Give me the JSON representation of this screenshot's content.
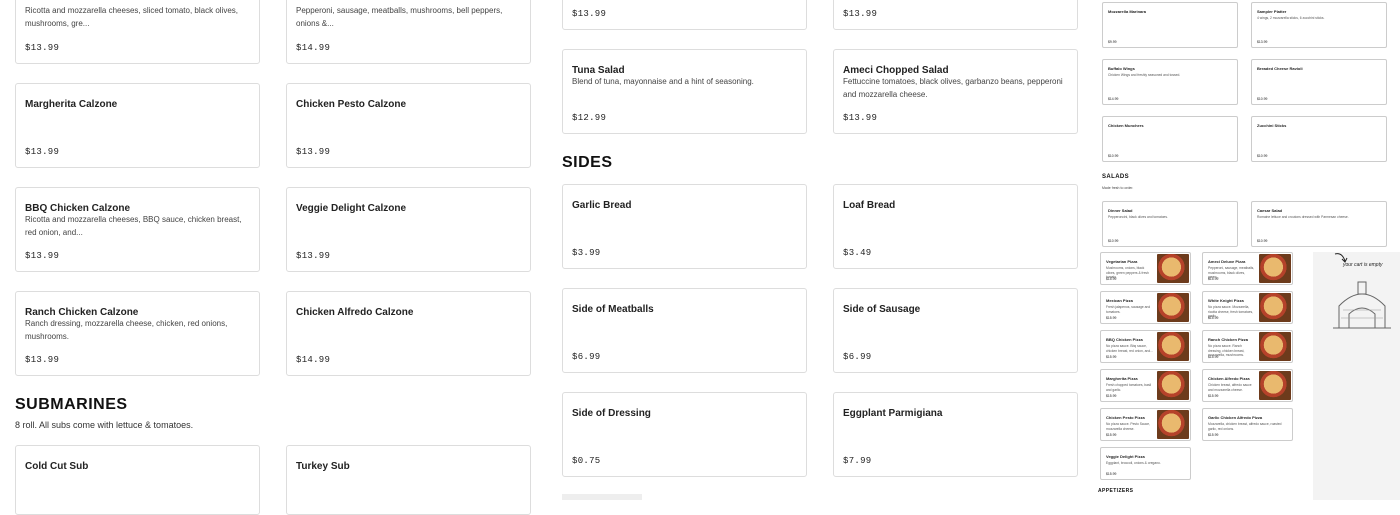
{
  "col1": [
    {
      "name": "",
      "desc": "Ricotta and mozzarella cheeses, sliced tomato, black olives, mushrooms, gre...",
      "price": "$13.99"
    },
    {
      "name": "Margherita Calzone",
      "desc": "",
      "price": "$13.99"
    },
    {
      "name": "BBQ Chicken Calzone",
      "desc": "Ricotta and mozzarella cheeses, BBQ sauce, chicken breast, red onion, and...",
      "price": "$13.99"
    },
    {
      "name": "Ranch Chicken Calzone",
      "desc": "Ranch dressing, mozzarella cheese, chicken, red onions, mushrooms.",
      "price": "$13.99"
    }
  ],
  "col2": [
    {
      "name": "",
      "desc": "Pepperoni, sausage, meatballs, mushrooms, bell peppers, onions &...",
      "price": "$14.99"
    },
    {
      "name": "Chicken Pesto Calzone",
      "desc": "",
      "price": "$13.99"
    },
    {
      "name": "Veggie Delight Calzone",
      "desc": "",
      "price": "$13.99"
    },
    {
      "name": "Chicken Alfredo Calzone",
      "desc": "",
      "price": "$14.99"
    }
  ],
  "submarines": {
    "title": "SUBMARINES",
    "subtitle": "8 roll. All subs come with lettuce & tomatoes.",
    "items": [
      {
        "name": "Cold Cut Sub"
      },
      {
        "name": "Turkey Sub"
      }
    ]
  },
  "col3": [
    {
      "name": "",
      "desc": "",
      "price": "$13.99"
    },
    {
      "name": "Tuna Salad",
      "desc": "Blend of tuna, mayonnaise and a hint of seasoning.",
      "price": "$12.99"
    }
  ],
  "col4": [
    {
      "name": "",
      "desc": "",
      "price": "$13.99"
    },
    {
      "name": "Ameci Chopped Salad",
      "desc": "Fettuccine tomatoes, black olives, garbanzo beans, pepperoni and mozzarella cheese.",
      "price": "$13.99"
    }
  ],
  "sides": {
    "title": "SIDES",
    "items": [
      {
        "name": "Garlic Bread",
        "price": "$3.99"
      },
      {
        "name": "Loaf Bread",
        "price": "$3.49"
      },
      {
        "name": "Side of Meatballs",
        "price": "$6.99"
      },
      {
        "name": "Side of Sausage",
        "price": "$6.99"
      },
      {
        "name": "Side of Dressing",
        "price": "$0.75"
      },
      {
        "name": "Eggplant Parmigiana",
        "price": "$7.99"
      }
    ]
  },
  "preview": {
    "top": [
      {
        "name": "Mozzarella Marinara",
        "desc": "",
        "price": "$9.99"
      },
      {
        "name": "Sampler Platter",
        "desc": "4 wings, 2 mozzarella sticks, 6 zucchini sticks.",
        "price": "$13.99"
      },
      {
        "name": "Buffalo Wings",
        "desc": "Chicken Wings and freshly seasoned and tossed.",
        "price": "$14.99"
      },
      {
        "name": "Breaded Cheese Ravioli",
        "desc": "",
        "price": "$10.99"
      },
      {
        "name": "Chicken Munchers",
        "desc": "",
        "price": "$10.99"
      },
      {
        "name": "Zucchini Sticks",
        "desc": "",
        "price": "$10.99"
      }
    ],
    "salads_title": "SALADS",
    "salads_sub": "Made fresh to order.",
    "salads": [
      {
        "name": "Dinner Salad",
        "desc": "Pepperoncini, black olives and tomatoes.",
        "price": "$10.99"
      },
      {
        "name": "Caesar Salad",
        "desc": "Romaine lettuce and croutons dressed with Parmesan cheese.",
        "price": "$10.99"
      }
    ],
    "pizzas": [
      {
        "name": "Vegetarian Pizza",
        "desc": "Mushrooms, onions, black olives, green peppers & fresh tomato.",
        "price": "$15.99"
      },
      {
        "name": "Ameci Deluxe Pizza",
        "desc": "Pepperoni, sausage, meatballs, mushrooms, black olives, green...",
        "price": "$15.99"
      },
      {
        "name": "Mexican Pizza",
        "desc": "Fresh jalapenos, sausage and tomatoes.",
        "price": "$15.99"
      },
      {
        "name": "White Knight Pizza",
        "desc": "No pizza sauce. Mozzarella, ricotta cheese, fresh tomatoes, garlic.",
        "price": "$15.99"
      },
      {
        "name": "BBQ Chicken Pizza",
        "desc": "No pizza sauce. Bbq sauce, chicken breast, red onion, and...",
        "price": "$15.99"
      },
      {
        "name": "Ranch Chicken Pizza",
        "desc": "No pizza sauce. Ranch dressing, chicken breast, mozzarella, mushrooms.",
        "price": "$15.99"
      },
      {
        "name": "Margherita Pizza",
        "desc": "Fresh chopped tomatoes, basil and garlic.",
        "price": "$15.99"
      },
      {
        "name": "Chicken Alfredo Pizza",
        "desc": "Chicken breast, alfredo sauce and mozzarella cheese.",
        "price": "$15.99"
      },
      {
        "name": "Chicken Pesto Pizza",
        "desc": "No pizza sauce. Pesto Sauce, mozzarella cheese.",
        "price": "$15.99"
      },
      {
        "name": "Garlic Chicken Alfredo Pizza",
        "desc": "Mozzarella, chicken breast, alfredo sauce, roasted garlic, red onions.",
        "price": "$15.99"
      },
      {
        "name": "Veggie Delight Pizza",
        "desc": "Eggplant, broccoli, onions & oregano.",
        "price": "$15.99"
      }
    ],
    "appetizers_title": "APPETIZERS",
    "cart_text": "your cart is empty"
  }
}
